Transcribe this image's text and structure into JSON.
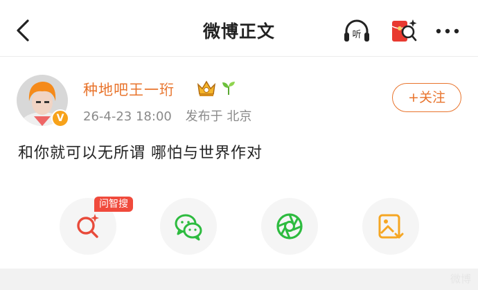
{
  "header": {
    "title": "微博正文",
    "listen_label": "听"
  },
  "post": {
    "username": "种地吧王一珩",
    "vip_badge": "V",
    "date": "26-4-23 18:00",
    "location": "发布于 北京",
    "follow_label": "+关注",
    "content": "和你就可以无所谓 哪怕与世界作对"
  },
  "share": {
    "ai_tag": "问智搜"
  },
  "watermark": "微博",
  "colors": {
    "accent": "#e8732b",
    "tag_red": "#f04a3c",
    "wechat_green": "#1aad19",
    "gold": "#f5a623"
  }
}
